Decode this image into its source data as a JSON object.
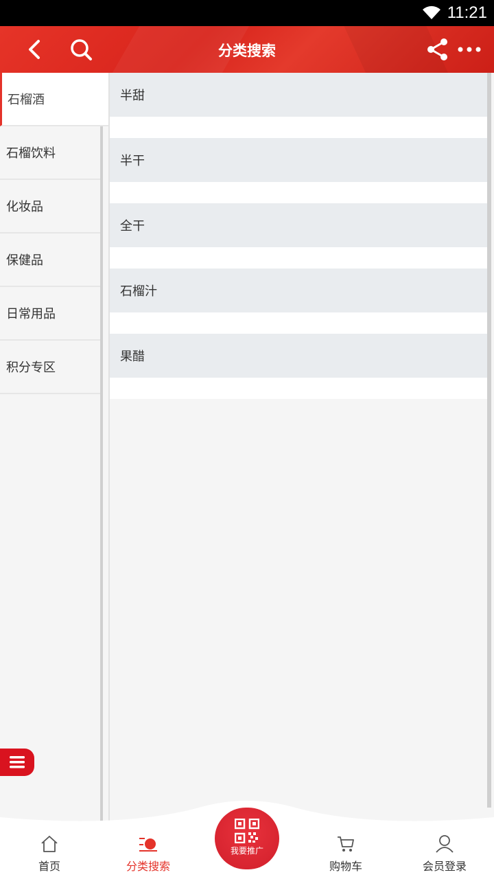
{
  "status_bar": {
    "time": "11:21"
  },
  "header": {
    "title": "分类搜索"
  },
  "categories": [
    {
      "label": "石榴酒",
      "active": true
    },
    {
      "label": "石榴饮料",
      "active": false
    },
    {
      "label": "化妆品",
      "active": false
    },
    {
      "label": "保健品",
      "active": false
    },
    {
      "label": "日常用品",
      "active": false
    },
    {
      "label": "积分专区",
      "active": false
    }
  ],
  "subcategories": [
    "半甜",
    "半干",
    "全干",
    "石榴汁",
    "果醋"
  ],
  "tabbar": {
    "home": "首页",
    "category": "分类搜索",
    "promote": "我要推广",
    "cart": "购物车",
    "login": "会员登录"
  },
  "colors": {
    "accent": "#e4332a",
    "header": "#dc2a20"
  },
  "icons": {
    "back": "chevron-left-icon",
    "search": "search-icon",
    "share": "share-icon",
    "more": "more-icon",
    "menu": "menu-icon",
    "home": "home-icon",
    "category": "category-icon",
    "qr": "qr-code-icon",
    "cart": "cart-icon",
    "user": "user-icon"
  }
}
